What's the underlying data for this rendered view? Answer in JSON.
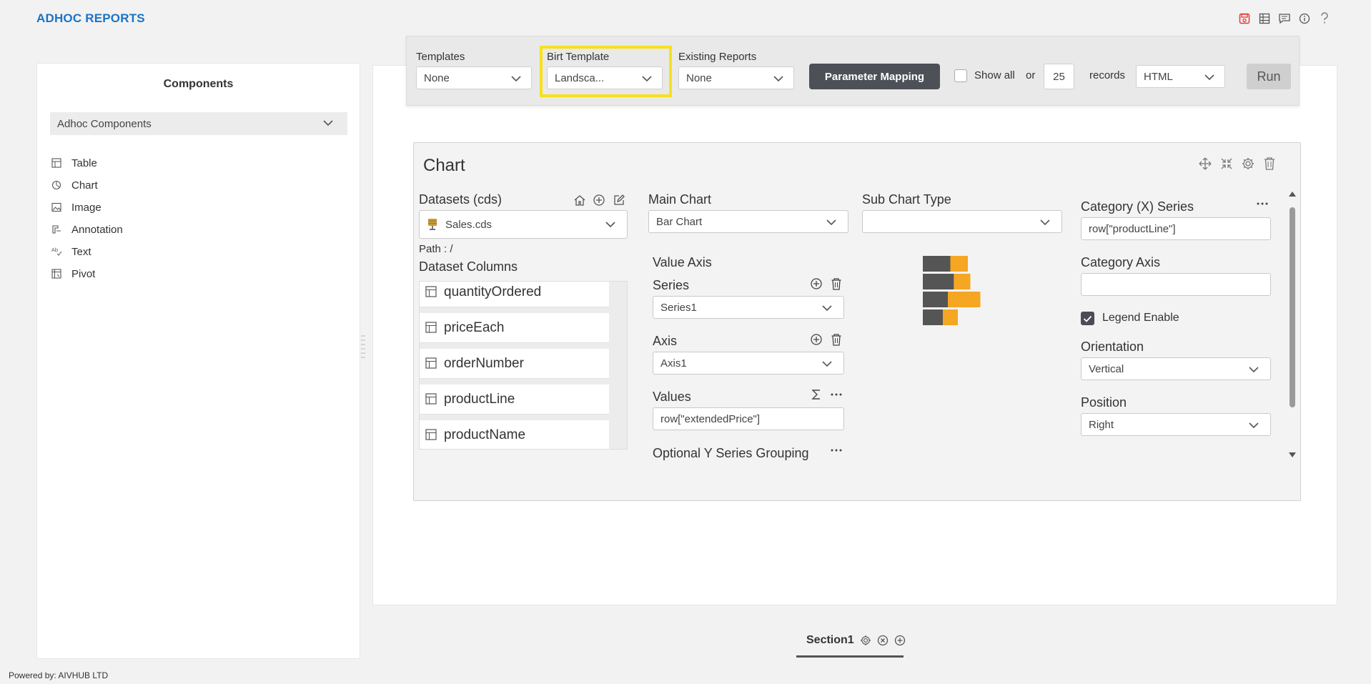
{
  "app": {
    "title": "ADHOC REPORTS",
    "footer": "Powered by: AIVHUB LTD"
  },
  "top_icons": [
    "save-icon",
    "grid-icon",
    "comment-icon",
    "info-icon",
    "help-icon"
  ],
  "components": {
    "title": "Components",
    "dropdown_value": "Adhoc Components",
    "items": [
      {
        "label": "Table",
        "icon": "table-icon"
      },
      {
        "label": "Chart",
        "icon": "chart-icon"
      },
      {
        "label": "Image",
        "icon": "image-icon"
      },
      {
        "label": "Annotation",
        "icon": "annotation-icon"
      },
      {
        "label": "Text",
        "icon": "text-icon"
      },
      {
        "label": "Pivot",
        "icon": "pivot-icon"
      }
    ]
  },
  "toolbar": {
    "templates_label": "Templates",
    "templates_value": "None",
    "birt_label": "Birt Template",
    "birt_value": "Landsca...",
    "existing_label": "Existing Reports",
    "existing_value": "None",
    "param_button": "Parameter Mapping",
    "show_all_label": "Show all",
    "or_label": "or",
    "records_value": "25",
    "records_label": "records",
    "format_value": "HTML",
    "run_button": "Run",
    "highlight_color": "#f7e11b"
  },
  "chart_card": {
    "title": "Chart",
    "datasets_label": "Datasets (cds)",
    "dataset_value": "Sales.cds",
    "path_label": "Path : /",
    "dataset_columns_label": "Dataset Columns",
    "columns": [
      "quantityOrdered",
      "priceEach",
      "orderNumber",
      "productLine",
      "productName"
    ],
    "main_chart_label": "Main Chart",
    "main_chart_value": "Bar Chart",
    "sub_chart_label": "Sub Chart Type",
    "sub_chart_value": "",
    "value_axis_label": "Value Axis",
    "series_label": "Series",
    "series_value": "Series1",
    "axis_label": "Axis",
    "axis_value": "Axis1",
    "values_label": "Values",
    "values_value": "row[\"extendedPrice\"]",
    "optional_label": "Optional Y Series Grouping",
    "category_x_label": "Category (X) Series",
    "category_x_value": "row[\"productLine\"]",
    "category_axis_label": "Category Axis",
    "category_axis_value": "",
    "legend_label": "Legend Enable",
    "legend_checked": true,
    "orientation_label": "Orientation",
    "orientation_value": "Vertical",
    "position_label": "Position",
    "position_value": "Right",
    "preview_colors": {
      "dark": "#555555",
      "accent": "#f5a623"
    },
    "preview_bars": [
      {
        "dark": 0.55,
        "accent": 0.35
      },
      {
        "dark": 0.62,
        "accent": 0.33
      },
      {
        "dark": 0.5,
        "accent": 0.65
      },
      {
        "dark": 0.4,
        "accent": 0.3
      }
    ]
  },
  "section": {
    "name": "Section1"
  }
}
